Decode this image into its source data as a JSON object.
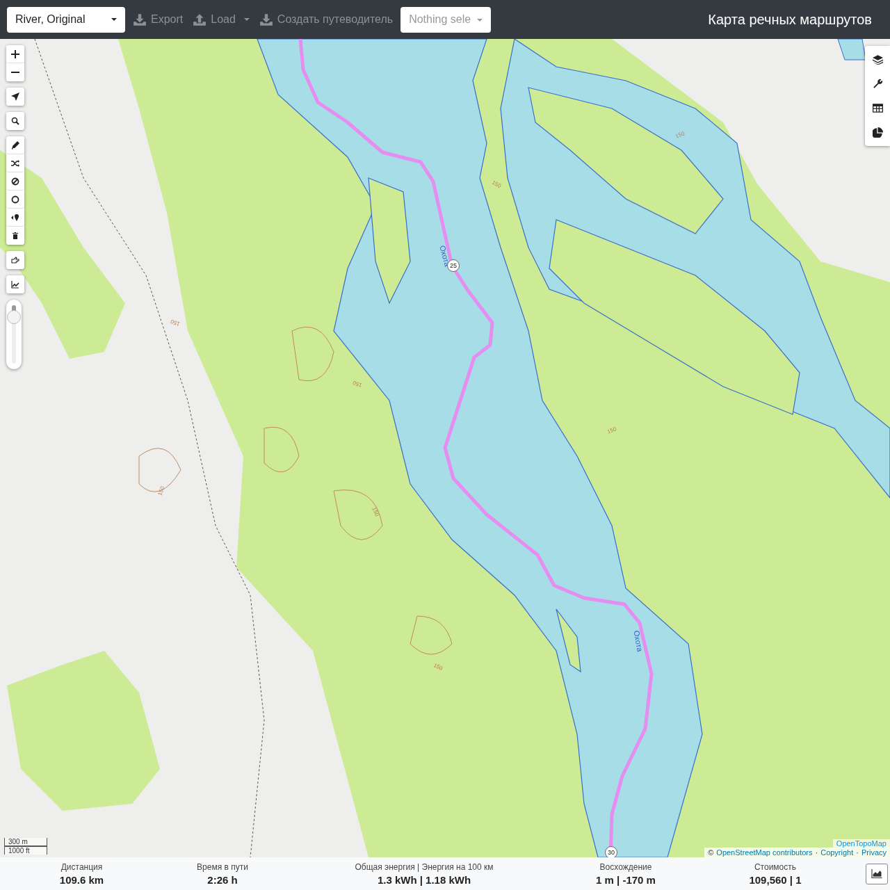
{
  "header": {
    "profile_select": "River, Original",
    "buttons": [
      {
        "label": "Export",
        "kind": "download",
        "dropdown": false
      },
      {
        "label": "Load",
        "kind": "upload",
        "dropdown": true
      },
      {
        "label": "Создать путеводитель",
        "kind": "download",
        "dropdown": false
      }
    ],
    "route_select": {
      "placeholder": "Nothing sele"
    },
    "title": "Карта речных маршрутов"
  },
  "map": {
    "river_labels": [
      "Охота",
      "Охота"
    ],
    "km_markers": [
      "25",
      "30"
    ],
    "contour_labels": [
      "150",
      "150",
      "150",
      "150",
      "150",
      "150",
      "150",
      "150"
    ],
    "scale": [
      "300 m",
      "1000 ft"
    ],
    "attribution": {
      "layer": "OpenTopoMap",
      "prefix": "©",
      "separator": "·",
      "links": [
        "OpenStreetMap contributors",
        "Copyright",
        "Privacy"
      ]
    },
    "opacity_slider": {
      "level": 0.8
    }
  },
  "stats": [
    {
      "label": "Дистанция",
      "value": "109.6 km"
    },
    {
      "label": "Время в пути",
      "value": "2:26 h"
    },
    {
      "label": "Общая энергия | Энергия на 100 км",
      "value": "1.3 kWh | 1.18 kWh"
    },
    {
      "label": "Восхождение",
      "value": "1 m | -170 m"
    },
    {
      "label": "Стоимость",
      "value": "109,560 | 1"
    }
  ]
}
